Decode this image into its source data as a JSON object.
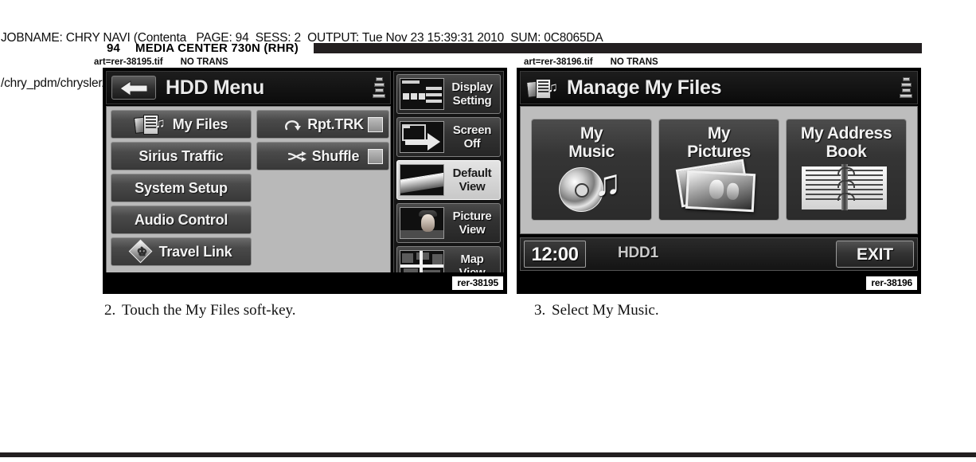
{
  "job_header": {
    "line1": "JOBNAME: CHRY NAVI (Contenta   PAGE: 94  SESS: 2  OUTPUT: Tue Nov 23 15:39:31 2010  SUM: 0C8065DA",
    "line2": "/chry_pdm/chrysler/navi/rhr/navi"
  },
  "page_title": {
    "page_number": "94",
    "title": "MEDIA CENTER 730N (RHR)"
  },
  "art_lines": {
    "left_file": "art=rer-38195.tif",
    "left_trans": "NO TRANS",
    "right_file": "art=rer-38196.tif",
    "right_trans": "NO TRANS"
  },
  "left_screen": {
    "id_tag": "rer-38195",
    "title": "HDD Menu",
    "back_label": "Back",
    "eq_icon": "equalizer-icon",
    "left_buttons": [
      {
        "label": "My Files",
        "icon": "media-files-icon"
      },
      {
        "label": "Sirius Traffic",
        "icon": ""
      },
      {
        "label": "System Setup",
        "icon": ""
      },
      {
        "label": "Audio Control",
        "icon": ""
      },
      {
        "label": "Travel Link",
        "icon": "travel-link-icon"
      }
    ],
    "right_buttons": [
      {
        "label": "Rpt.TRK",
        "icon": "repeat-icon",
        "checkbox": true,
        "checked": false
      },
      {
        "label": "Shuffle",
        "icon": "shuffle-icon",
        "checkbox": true,
        "checked": false
      }
    ],
    "rail_buttons": [
      {
        "line1": "Display",
        "line2": "Setting",
        "thumb": "display-setting-thumb",
        "selected": false
      },
      {
        "line1": "Screen",
        "line2": "Off",
        "thumb": "screen-off-thumb",
        "selected": false
      },
      {
        "line1": "Default",
        "line2": "View",
        "thumb": "default-view-thumb",
        "selected": true
      },
      {
        "line1": "Picture",
        "line2": "View",
        "thumb": "picture-view-thumb",
        "selected": false
      },
      {
        "line1": "Map",
        "line2": "View",
        "thumb": "map-view-thumb",
        "selected": false
      }
    ]
  },
  "right_screen": {
    "id_tag": "rer-38196",
    "title": "Manage My Files",
    "eq_icon": "equalizer-icon",
    "tiles": [
      {
        "line1": "My",
        "line2": "Music",
        "art": "cd-music-note-icon"
      },
      {
        "line1": "My",
        "line2": "Pictures",
        "art": "photo-stack-icon"
      },
      {
        "line1": "My Address",
        "line2": "Book",
        "art": "address-book-icon"
      }
    ],
    "status": {
      "clock": "12:00",
      "source": "HDD1",
      "exit_label": "EXIT"
    }
  },
  "captions": {
    "left": {
      "number": "2.",
      "text": "Touch the My Files soft-key."
    },
    "right": {
      "number": "3.",
      "text": "Select My Music."
    }
  },
  "colors": {
    "ink": "#231f20",
    "paper": "#ffffff",
    "screen_bezel": "#000000",
    "panel_grey": "#b9b9b9",
    "softkey_face": "#4a4a4a",
    "selected_key": "#d8d8d8"
  }
}
